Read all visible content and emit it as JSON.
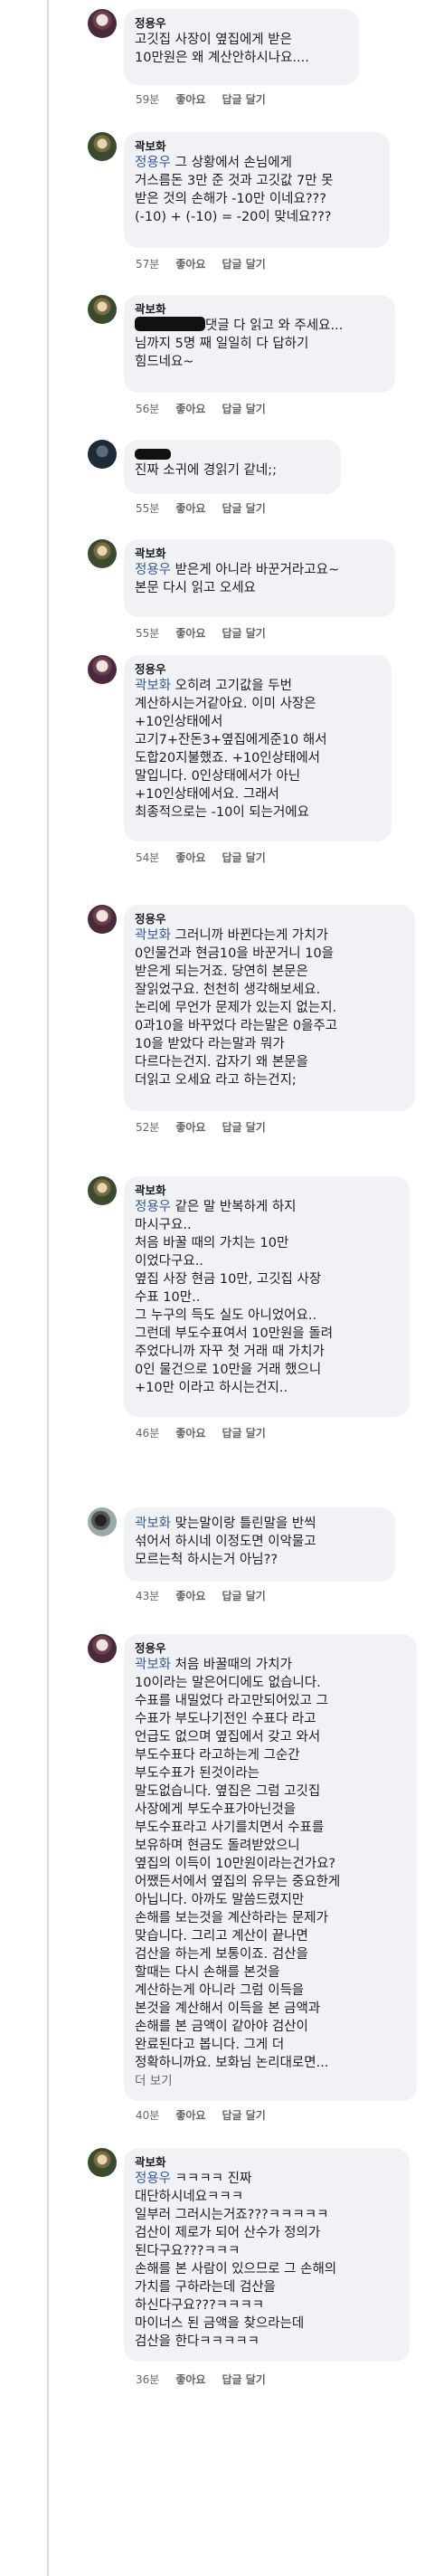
{
  "comments": [
    {
      "author": "정용우",
      "mention": "",
      "lines": [
        "고깃집 사장이 옆집에게 받은",
        "10만원은 왜 계산안하시나요...."
      ],
      "time": "59분",
      "like": "좋아요",
      "reply": "답글 달기"
    },
    {
      "author": "곽보화",
      "mention": "정용우",
      "lines": [
        " 그 상황에서 손님에게",
        "거스름돈 3만 준 것과 고깃값 7만 못",
        "받은 것의 손해가 -10만 이네요???",
        "(-10) + (-10) = -20이 맞네요???"
      ],
      "time": "57분",
      "like": "좋아요",
      "reply": "답글 달기"
    },
    {
      "author": "곽보화",
      "mention": "",
      "lines": [
        "댓글 다 읽고 와 주세요...",
        "님까지 5명 째 일일히 다 답하기",
        "힘드네요~"
      ],
      "time": "56분",
      "like": "좋아요",
      "reply": "답글 달기"
    },
    {
      "author": "",
      "mention": "",
      "lines": [
        "진짜 소귀에 경읽기 같네;;"
      ],
      "time": "55분",
      "like": "좋아요",
      "reply": "답글 달기"
    },
    {
      "author": "곽보화",
      "mention": "정용우",
      "lines": [
        " 받은게 아니라 바꾼거라고요~",
        "본문 다시 읽고 오세요"
      ],
      "time": "55분",
      "like": "좋아요",
      "reply": "답글 달기"
    },
    {
      "author": "정용우",
      "mention": "곽보화",
      "lines": [
        " 오히려 고기값을 두번",
        "계산하시는거같아요. 이미 사장은",
        "+10인상태에서",
        "고기7+잔돈3+옆집에게준10 해서",
        "도합20지불했죠. +10인상태에서",
        "말입니다. 0인상태에서가 아닌",
        "+10인상태에서요. 그래서",
        "최종적으로는 -10이 되는거에요"
      ],
      "time": "54분",
      "like": "좋아요",
      "reply": "답글 달기"
    },
    {
      "author": "정용우",
      "mention": "곽보화",
      "lines": [
        " 그러니까 바뀐다는게 가치가",
        "0인물건과 현금10을 바꾼거니 10을",
        "받은게 되는거죠. 당연히 본문은",
        "잘읽었구요. 천천히 생각해보세요.",
        "논리에 무언가 문제가 있는지 없는지.",
        "0과10을 바꾸었다 라는말은 0을주고",
        "10을 받았다 라는말과 뭐가",
        "다르다는건지. 갑자기 왜 본문을",
        "더읽고 오세요 라고 하는건지;"
      ],
      "time": "52분",
      "like": "좋아요",
      "reply": "답글 달기"
    },
    {
      "author": "곽보화",
      "mention": "정용우",
      "lines": [
        " 같은 말 반복하게 하지",
        "마시구요..",
        "처음 바꿀 때의 가치는 10만",
        "이었다구요..",
        "옆집 사장 현금 10만, 고깃집 사장",
        "수표 10만..",
        "그 누구의 득도 실도 아니었어요..",
        "그런데 부도수표여서 10만원을 돌려",
        "주었다니까 자꾸 첫 거래 때 가치가",
        "0인 물건으로 10만을 거래 했으니",
        "+10만 이라고 하시는건지.."
      ],
      "time": "46분",
      "like": "좋아요",
      "reply": "답글 달기"
    },
    {
      "author": "",
      "mention": "곽보화",
      "lines": [
        " 맞는말이랑 틀린말을 반씩",
        "섞어서 하시네 이정도면 이악물고",
        "모르는척 하시는거 아님??"
      ],
      "time": "43분",
      "like": "좋아요",
      "reply": "답글 달기"
    },
    {
      "author": "정용우",
      "mention": "곽보화",
      "lines": [
        " 처음 바꿀때의 가치가",
        "10이라는 말은어디에도 없습니다.",
        "수표를 내밀었다 라고만되어있고 그",
        "수표가 부도나기전인 수표다 라고",
        "언급도 없으며 옆집에서 갖고 와서",
        "부도수표다 라고하는게 그순간",
        "부도수표가 된것이라는",
        "말도없습니다. 옆집은 그럼 고깃집",
        "사장에게 부도수표가아닌것을",
        "부도수표라고 사기를치면서 수표를",
        "보유하며 현금도 돌려받았으니",
        "옆집의 이득이 10만원이라는건가요?",
        "어쨌든서에서 옆집의 유무는 중요한게",
        "아닙니다. 아까도 말씀드렸지만",
        "손해를 보는것을 계산하라는 문제가",
        "맞습니다. 그리고 계산이 끝나면",
        "검산을 하는게 보통이죠. 검산을",
        "할때는 다시 손해를 본것을",
        "계산하는게 아니라 그럼 이득을",
        "본것을 계산해서 이득을 본 금액과",
        "손해를 본 금액이 같아야 검산이",
        "완료된다고 봅니다. 그게 더",
        "정확하니까요. 보화님 논리대로면..."
      ],
      "more": "더 보기",
      "time": "40분",
      "like": "좋아요",
      "reply": "답글 달기"
    },
    {
      "author": "곽보화",
      "mention": "정용우",
      "lines": [
        " ㅋㅋㅋㅋ 진짜",
        "대단하시네요ㅋㅋㅋ",
        "일부러 그러시는거죠???ㅋㅋㅋㅋㅋ",
        "검산이 제로가 되어 산수가 정의가",
        "된다구요???ㅋㅋㅋ",
        "손해를 본 사람이 있으므로 그 손해의",
        "가치를 구하라는데 검산을",
        "하신다구요???ㅋㅋㅋㅋ",
        "마이너스 된 금액을 찾으라는데",
        "검산을 한다ㅋㅋㅋㅋㅋ"
      ],
      "time": "36분",
      "like": "좋아요",
      "reply": "답글 달기"
    }
  ]
}
